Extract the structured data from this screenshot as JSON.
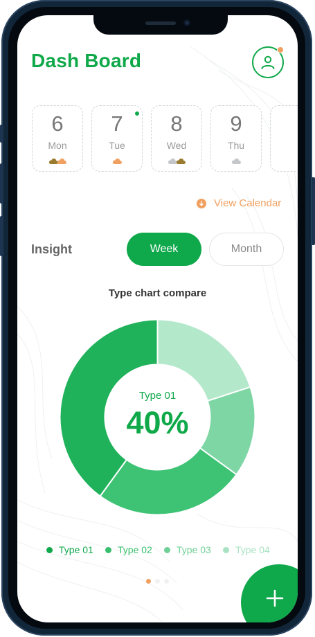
{
  "header": {
    "title": "Dash Board",
    "profile_icon": "user-icon"
  },
  "calendar": {
    "days": [
      {
        "num": "6",
        "name": "Mon",
        "weather": [
          "brown-cloud",
          "orange-cloud"
        ],
        "active": false
      },
      {
        "num": "7",
        "name": "Tue",
        "weather": [
          "orange-cloud"
        ],
        "active": true
      },
      {
        "num": "8",
        "name": "Wed",
        "weather": [
          "gray-cloud",
          "brown-cloud"
        ],
        "active": false
      },
      {
        "num": "9",
        "name": "Thu",
        "weather": [
          "gray-cloud"
        ],
        "active": false
      }
    ],
    "view_label": "View Calendar"
  },
  "insight": {
    "label": "Insight",
    "tabs": [
      {
        "label": "Week",
        "selected": true
      },
      {
        "label": "Month",
        "selected": false
      }
    ]
  },
  "chart_data": {
    "type": "pie",
    "title": "Type chart compare",
    "categories": [
      "Type 01",
      "Type 02",
      "Type 03",
      "Type 04"
    ],
    "values": [
      40,
      25,
      15,
      20
    ],
    "colors": [
      "#1fb25a",
      "#3ec375",
      "#7dd6a4",
      "#b4e8cb"
    ],
    "center_label": "Type 01",
    "center_value": "40%"
  },
  "legend": [
    {
      "label": "Type 01",
      "color": "#0fa84b"
    },
    {
      "label": "Type 02",
      "color": "#38bf6e"
    },
    {
      "label": "Type 03",
      "color": "#6fd096"
    },
    {
      "label": "Type 04",
      "color": "#a8e2c1"
    }
  ],
  "pager": {
    "pages": 3,
    "current": 1
  },
  "colors": {
    "accent": "#10a94a",
    "secondary": "#f0a060",
    "frame": "#12263a"
  },
  "fab": {
    "icon": "plus-icon"
  }
}
